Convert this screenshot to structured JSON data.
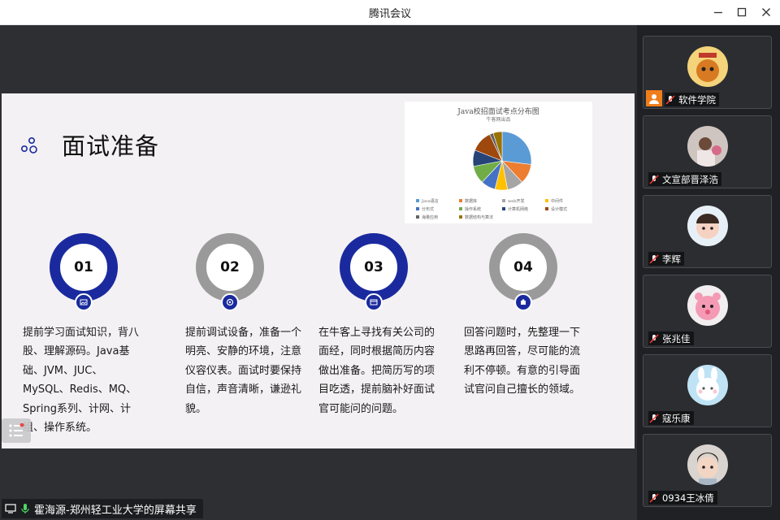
{
  "window": {
    "title": "腾讯会议"
  },
  "slide": {
    "title": "面试准备",
    "chart": {
      "title": "Java校招面试考点分布图",
      "subtitle": "牛客网出品"
    },
    "steps": [
      {
        "num": "01",
        "text": "提前学习面试知识，背八股、理解源码。Java基础、JVM、JUC、MySQL、Redis、MQ、Spring系列、计网、计组、操作系统。"
      },
      {
        "num": "02",
        "text": "提前调试设备，准备一个明亮、安静的环境，注意仪容仪表。面试时要保持自信，声音清晰，谦逊礼貌。"
      },
      {
        "num": "03",
        "text": "在牛客上寻找有关公司的面经，同时根据简历内容做出准备。把简历写的项目吃透，提前脑补好面试官可能问的问题。"
      },
      {
        "num": "04",
        "text": "回答问题时，先整理一下思路再回答，尽可能的流利不停顿。有意的引导面试官问自己擅长的领域。"
      }
    ]
  },
  "chart_data": {
    "type": "pie",
    "title": "Java校招面试考点分布图",
    "subtitle": "牛客网出品",
    "labels": [
      "Java语言",
      "数据库",
      "web开发",
      "中间件",
      "分布式",
      "操作系统",
      "计算机网络",
      "设计模式",
      "海量应用",
      "数据结构与算法"
    ],
    "values": [
      27,
      11,
      9,
      7,
      8,
      10,
      9,
      12,
      2,
      5
    ],
    "colors": [
      "#5b9bd5",
      "#ed7d31",
      "#a5a5a5",
      "#ffc000",
      "#4472c4",
      "#70ad47",
      "#264478",
      "#9e480e",
      "#636363",
      "#997300"
    ],
    "legend_position": "bottom"
  },
  "sharer": {
    "label": "霍海源-郑州轻工业大学的屏幕共享"
  },
  "participants": [
    {
      "name": "软件学院",
      "avatar": "tiger-avatar",
      "host": true
    },
    {
      "name": "文宣部晋泽浩",
      "avatar": "photo-avatar",
      "host": false
    },
    {
      "name": "李辉",
      "avatar": "child-avatar",
      "host": false
    },
    {
      "name": "张兆佳",
      "avatar": "pink-bear-avatar",
      "host": false
    },
    {
      "name": "寇乐康",
      "avatar": "bunny-avatar",
      "host": false
    },
    {
      "name": "0934王冰倩",
      "avatar": "girl-avatar",
      "host": false
    }
  ]
}
